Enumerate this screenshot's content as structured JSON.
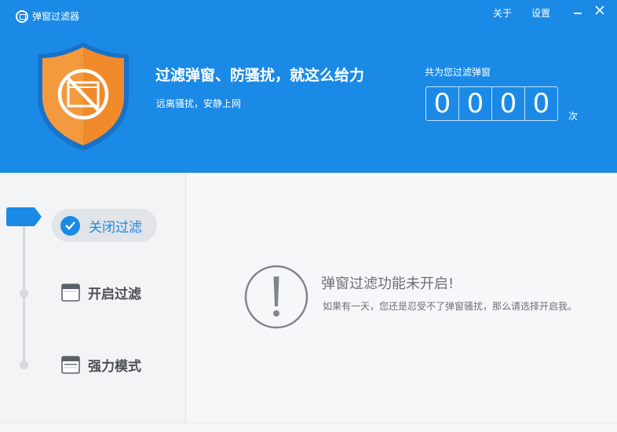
{
  "window": {
    "title": "弹窗过滤器",
    "about_label": "关于",
    "settings_label": "设置"
  },
  "banner": {
    "headline": "过滤弹窗、防骚扰，就这么给力",
    "subline": "远离骚扰，安静上网",
    "counter_label": "共为您过滤弹窗",
    "counter_digits": [
      "0",
      "0",
      "0",
      "0"
    ],
    "counter_unit": "次"
  },
  "sidebar": {
    "items": [
      {
        "label": "关闭过滤",
        "active": true
      },
      {
        "label": "开启过滤",
        "active": false
      },
      {
        "label": "强力模式",
        "active": false
      }
    ]
  },
  "main": {
    "status_title": "弹窗过滤功能未开启!",
    "status_desc": "如果有一天，您还是忍受不了弹窗骚扰，那么请选择开启我。"
  },
  "colors": {
    "brand_blue": "#1a8ae6",
    "shield_orange": "#f08a2a",
    "text_gray": "#6a7078"
  },
  "icons": [
    "app-logo-icon",
    "minimize-icon",
    "close-icon",
    "shield-block-icon",
    "checkmark-icon",
    "window-icon",
    "warning-icon"
  ]
}
